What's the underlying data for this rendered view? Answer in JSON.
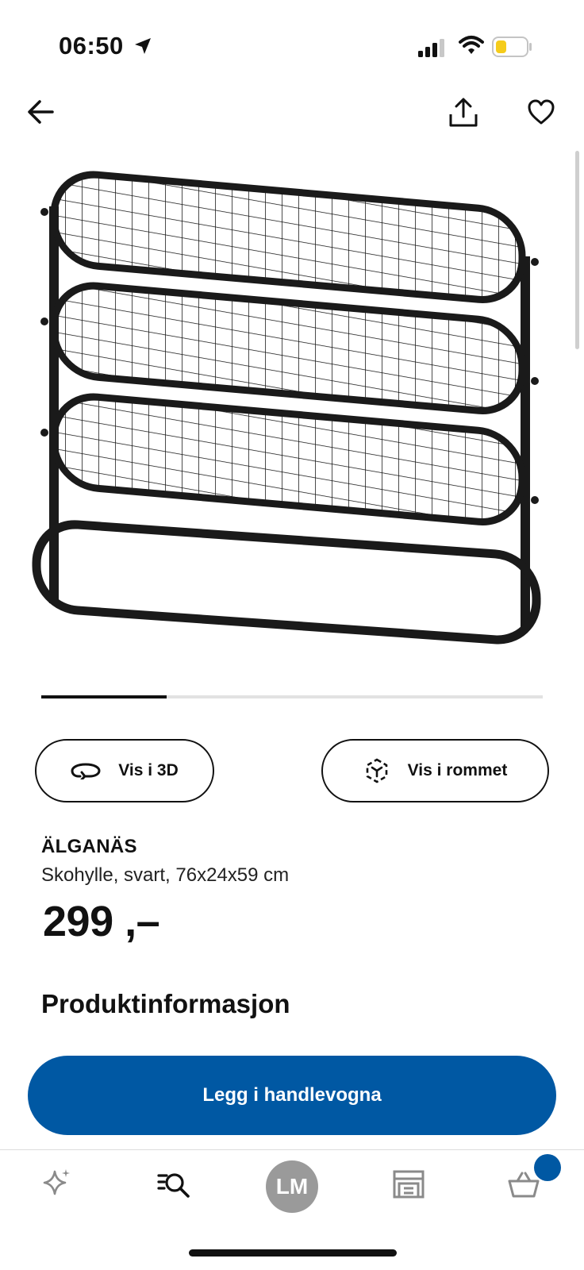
{
  "status_bar": {
    "time": "06:50",
    "icons": [
      "location-arrow-icon",
      "signal-icon",
      "wifi-icon",
      "battery-icon"
    ]
  },
  "nav": {
    "icons": [
      "back-arrow-icon",
      "share-icon",
      "heart-icon"
    ]
  },
  "gallery": {
    "progress": 0.25
  },
  "actions": {
    "view_3d": "Vis i 3D",
    "view_room": "Vis i rommet"
  },
  "product": {
    "name": "ÄLGANÄS",
    "description": "Skohylle, svart, 76x24x59 cm",
    "price": "299 ,–"
  },
  "section": {
    "title": "Produktinformasjon"
  },
  "cta": {
    "label": "Legg i handlevogna",
    "color": "#0058a3"
  },
  "tabbar": {
    "avatar_initials": "LM",
    "icons": [
      "sparkle-icon",
      "search-list-icon",
      "avatar",
      "store-icon",
      "basket-icon"
    ]
  }
}
